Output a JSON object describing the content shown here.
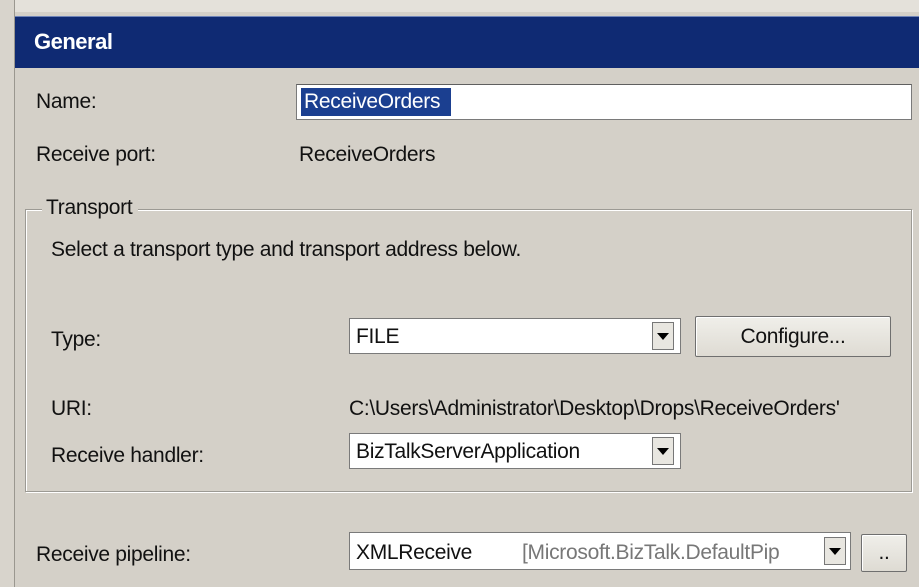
{
  "header": {
    "title": "General"
  },
  "general": {
    "name_label": "Name:",
    "name_value": "ReceiveOrders",
    "receive_port_label": "Receive port:",
    "receive_port_value": "ReceiveOrders"
  },
  "transport": {
    "legend": "Transport",
    "description": "Select a transport type and transport address below.",
    "type_label": "Type:",
    "type_value": "FILE",
    "configure_label": "Configure...",
    "uri_label": "URI:",
    "uri_value": "C:\\Users\\Administrator\\Desktop\\Drops\\ReceiveOrders'",
    "handler_label": "Receive handler:",
    "handler_value": "BizTalkServerApplication"
  },
  "pipeline": {
    "label": "Receive pipeline:",
    "name": "XMLReceive",
    "assembly": "[Microsoft.BizTalk.DefaultPip",
    "browse_label": ".."
  }
}
